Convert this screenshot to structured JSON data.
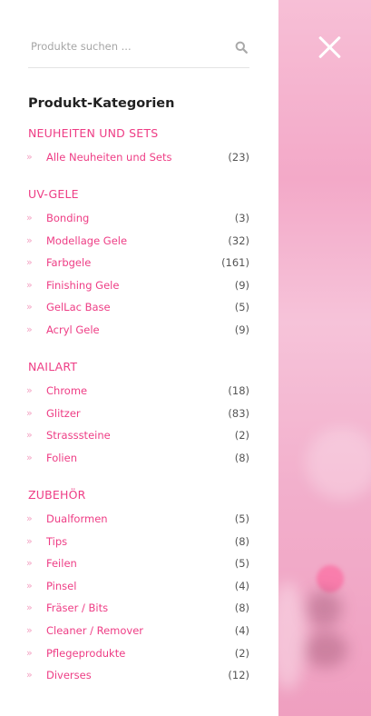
{
  "search": {
    "placeholder": "Produkte suchen ..."
  },
  "categories_title": "Produkt-Kategorien",
  "arrow": "»",
  "groups": [
    {
      "heading": "NEUHEITEN UND SETS",
      "items": [
        {
          "label": "Alle Neuheiten und Sets",
          "count": "(23)"
        }
      ]
    },
    {
      "heading": "UV-GELE",
      "items": [
        {
          "label": "Bonding",
          "count": "(3)"
        },
        {
          "label": "Modellage Gele",
          "count": "(32)"
        },
        {
          "label": "Farbgele",
          "count": "(161)"
        },
        {
          "label": "Finishing Gele",
          "count": "(9)"
        },
        {
          "label": "GelLac Base",
          "count": "(5)"
        },
        {
          "label": "Acryl Gele",
          "count": "(9)"
        }
      ]
    },
    {
      "heading": "NAILART",
      "items": [
        {
          "label": "Chrome",
          "count": "(18)"
        },
        {
          "label": "Glitzer",
          "count": "(83)"
        },
        {
          "label": "Strasssteine",
          "count": "(2)"
        },
        {
          "label": "Folien",
          "count": "(8)"
        }
      ]
    },
    {
      "heading": "ZUBEHÖR",
      "items": [
        {
          "label": "Dualformen",
          "count": "(5)"
        },
        {
          "label": "Tips",
          "count": "(8)"
        },
        {
          "label": "Feilen",
          "count": "(5)"
        },
        {
          "label": "Pinsel",
          "count": "(4)"
        },
        {
          "label": "Fräser / Bits",
          "count": "(8)"
        },
        {
          "label": "Cleaner / Remover",
          "count": "(4)"
        },
        {
          "label": "Pflegeprodukte",
          "count": "(2)"
        },
        {
          "label": "Diverses",
          "count": "(12)"
        }
      ]
    }
  ],
  "colors": {
    "accent": "#ee3d85",
    "arrow": "#f4a3c3",
    "count": "#555555"
  }
}
